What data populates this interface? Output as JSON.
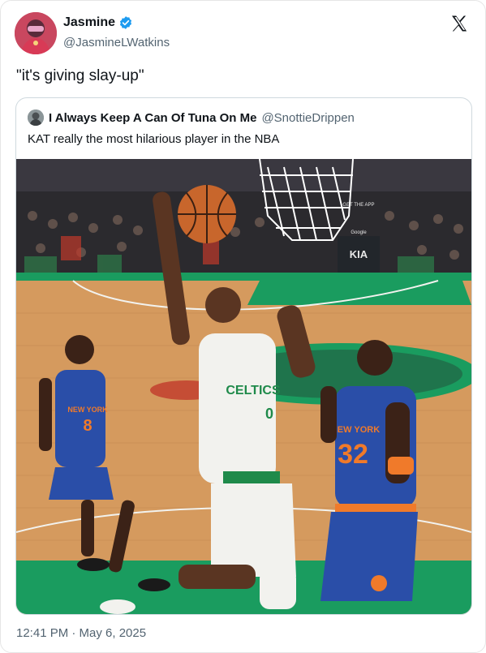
{
  "author": {
    "display_name": "Jasmine",
    "handle": "@JasmineLWatkins",
    "verified": true,
    "avatar_icon": "profile-avatar"
  },
  "platform_icon": "x-logo-icon",
  "tweet": {
    "text": "\"it's giving slay-up\"",
    "timestamp": "12:41 PM · May 6, 2025"
  },
  "quoted_tweet": {
    "author": {
      "display_name": "I Always Keep A Can Of Tuna On Me",
      "handle": "@SnottieDrippen"
    },
    "text": "KAT really the most hilarious player in the NBA",
    "media": {
      "type": "photo",
      "signage": [
        "KIA",
        "GET THE APP",
        "Google"
      ],
      "jersey_left": {
        "team": "NEW YORK",
        "number": "8"
      },
      "jersey_center": {
        "team": "CELTICS",
        "number": "0"
      },
      "jersey_right": {
        "team": "NEW YORK",
        "number": "32"
      },
      "colors": {
        "court_wood": "#d59a5e",
        "paint_green": "#1a9c5f",
        "knicks_blue": "#2a4ea8",
        "knicks_orange": "#f07a2a",
        "celtics_white": "#f2f2ee",
        "celtics_green": "#1f8a4a",
        "ball": "#c8662c"
      }
    }
  },
  "colors": {
    "verified_blue": "#1d9bf0",
    "text_primary": "#0f1419",
    "text_secondary": "#536471",
    "border": "#cfd9de"
  }
}
